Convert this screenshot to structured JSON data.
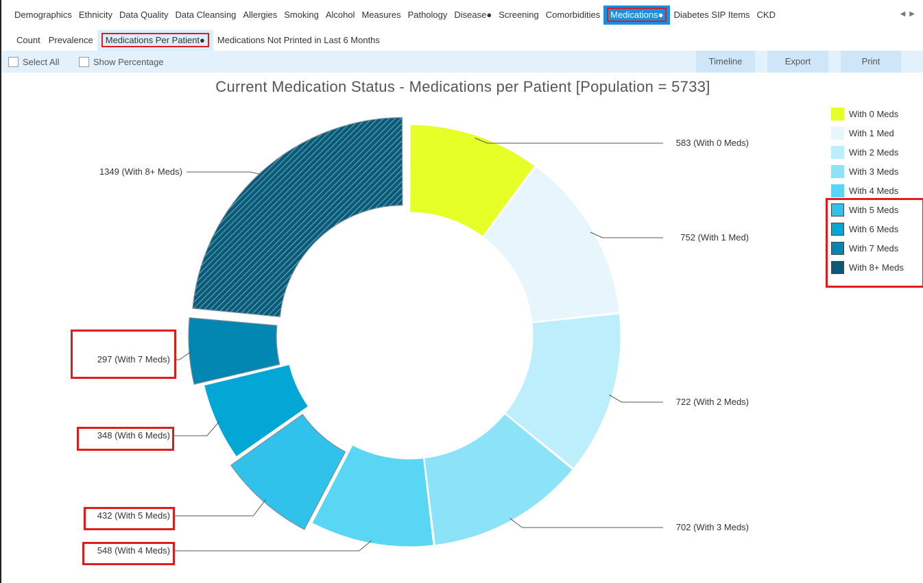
{
  "top_tabs": [
    "Demographics",
    "Ethnicity",
    "Data Quality",
    "Data Cleansing",
    "Allergies",
    "Smoking",
    "Alcohol",
    "Measures",
    "Pathology",
    "Disease●",
    "Screening",
    "Comorbidities",
    "Medications●",
    "Diabetes SIP Items",
    "CKD"
  ],
  "sub_tabs": [
    "Count",
    "Prevalence",
    "Medications Per Patient●",
    "Medications Not Printed in Last 6 Months"
  ],
  "toolbar": {
    "select_all": "Select All",
    "show_percentage": "Show Percentage",
    "timeline": "Timeline",
    "export": "Export",
    "print": "Print"
  },
  "chart_data": {
    "type": "pie",
    "donut": true,
    "title": "Current Medication Status - Medications per Patient [Population = 5733]",
    "categories": [
      "With 0 Meds",
      "With 1 Med",
      "With 2 Meds",
      "With 3 Meds",
      "With 4 Meds",
      "With 5 Meds",
      "With 6 Meds",
      "With 7 Meds",
      "With 8+ Meds"
    ],
    "values": [
      583,
      752,
      722,
      702,
      548,
      432,
      348,
      297,
      1349
    ],
    "labels": [
      "583 (With 0 Meds)",
      "752 (With 1 Med)",
      "722 (With 2 Meds)",
      "702 (With 3 Meds)",
      "548 (With 4 Meds)",
      "432 (With 5 Meds)",
      "348 (With 6 Meds)",
      "297 (With 7 Meds)",
      "1349 (With 8+ Meds)"
    ],
    "colors": [
      "#e6ff26",
      "#e6f6fc",
      "#bdeefb",
      "#8ce3f8",
      "#58d6f3",
      "#30c2ea",
      "#02a7d6",
      "#0286b2",
      "#0b5a77"
    ],
    "exploded": [
      "With 5 Meds",
      "With 7 Meds",
      "With 8+ Meds"
    ],
    "legend_placement": "right"
  }
}
